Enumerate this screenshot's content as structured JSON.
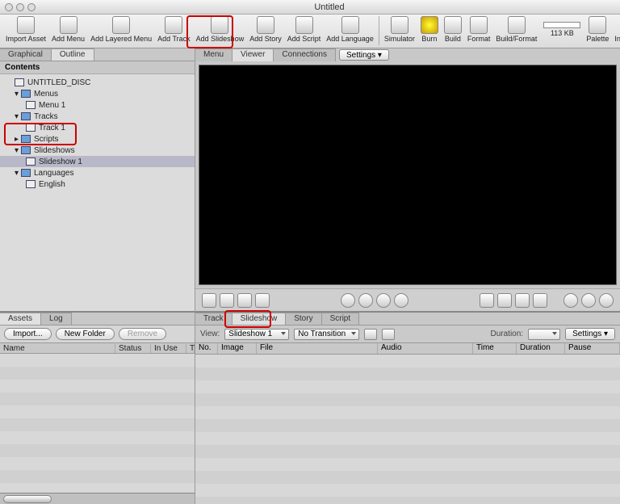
{
  "window": {
    "title": "Untitled"
  },
  "toolbar": {
    "items": [
      {
        "label": "Import Asset"
      },
      {
        "label": "Add Menu"
      },
      {
        "label": "Add Layered Menu"
      },
      {
        "label": "Add Track"
      },
      {
        "label": "Add Slideshow"
      },
      {
        "label": "Add Story"
      },
      {
        "label": "Add Script"
      },
      {
        "label": "Add Language"
      }
    ],
    "items2": [
      {
        "label": "Simulator"
      },
      {
        "label": "Burn"
      },
      {
        "label": "Build"
      },
      {
        "label": "Format"
      },
      {
        "label": "Build/Format"
      }
    ],
    "disk_size": "113 KB",
    "items3": [
      {
        "label": "Palette"
      },
      {
        "label": "Inspector"
      }
    ]
  },
  "outline": {
    "tabs": {
      "graphical": "Graphical",
      "outline": "Outline"
    },
    "header": "Contents",
    "tree": {
      "root": "UNTITLED_DISC",
      "menus": "Menus",
      "menu1": "Menu 1",
      "tracks": "Tracks",
      "track1": "Track 1",
      "scripts": "Scripts",
      "slideshows": "Slideshows",
      "slideshow1": "Slideshow 1",
      "languages": "Languages",
      "english": "English"
    }
  },
  "assets": {
    "tabs": {
      "assets": "Assets",
      "log": "Log"
    },
    "buttons": {
      "import": "Import...",
      "newfolder": "New Folder",
      "remove": "Remove"
    },
    "cols": {
      "name": "Name",
      "status": "Status",
      "inuse": "In Use",
      "t": "T"
    }
  },
  "viewer": {
    "tabs": {
      "menu": "Menu",
      "viewer": "Viewer",
      "connections": "Connections"
    },
    "settings": "Settings ▾"
  },
  "slideshow": {
    "tabs": {
      "track": "Track",
      "slideshow": "Slideshow",
      "story": "Story",
      "script": "Script"
    },
    "view_label": "View:",
    "view_value": "Slideshow 1",
    "transition": "No Transition",
    "duration_label": "Duration:",
    "settings": "Settings ▾",
    "cols": {
      "no": "No.",
      "image": "Image",
      "file": "File",
      "audio": "Audio",
      "time": "Time",
      "duration": "Duration",
      "pause": "Pause"
    }
  }
}
